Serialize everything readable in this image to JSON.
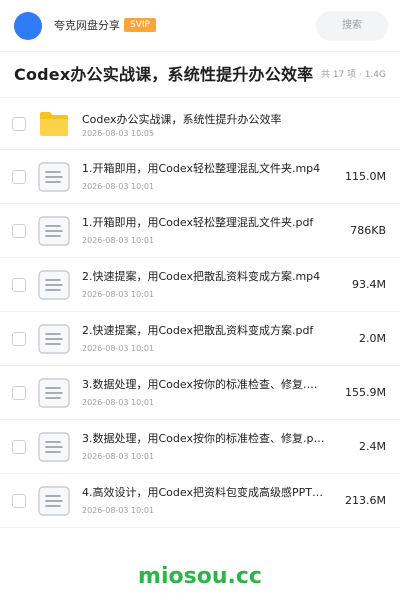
{
  "header": {
    "user_name": "夸克网盘分享",
    "badge": "SVIP",
    "search_placeholder": "搜索"
  },
  "title_bar": {
    "title": "Codex办公实战课，系统性提升办公效率",
    "meta": "共 17 项 · 1.4G"
  },
  "files": [
    {
      "type": "folder",
      "icon": "folder-icon",
      "name": "Codex办公实战课，系统性提升办公效率",
      "date": "2026-08-03 10:05",
      "size": ""
    },
    {
      "type": "file",
      "icon": "document-icon",
      "name": "1.开箱即用，用Codex轻松整理混乱文件夹.mp4",
      "date": "2026-08-03 10:01",
      "size": "115.0M"
    },
    {
      "type": "file",
      "icon": "document-icon",
      "name": "1.开箱即用，用Codex轻松整理混乱文件夹.pdf",
      "date": "2026-08-03 10:01",
      "size": "786KB"
    },
    {
      "type": "file",
      "icon": "document-icon",
      "name": "2.快速提案，用Codex把散乱资料变成方案.mp4",
      "date": "2026-08-03 10:01",
      "size": "93.4M"
    },
    {
      "type": "file",
      "icon": "document-icon",
      "name": "2.快速提案，用Codex把散乱资料变成方案.pdf",
      "date": "2026-08-03 10:01",
      "size": "2.0M"
    },
    {
      "type": "file",
      "icon": "document-icon",
      "name": "3.数据处理，用Codex按你的标准检查、修复.m…",
      "date": "2026-08-03 10:01",
      "size": "155.9M"
    },
    {
      "type": "file",
      "icon": "document-icon",
      "name": "3.数据处理，用Codex按你的标准检查、修复.p…",
      "date": "2026-08-03 10:01",
      "size": "2.4M"
    },
    {
      "type": "file",
      "icon": "document-icon",
      "name": "4.高效设计，用Codex把资料包变成高级感PPT…",
      "date": "2026-08-03 10:01",
      "size": "213.6M"
    }
  ],
  "watermark": "miosou.cc",
  "colors": {
    "avatar": "#2f7bf6",
    "svip_badge": "#f7a637",
    "folder": "#f8c21c",
    "watermark": "#2fb34a"
  }
}
